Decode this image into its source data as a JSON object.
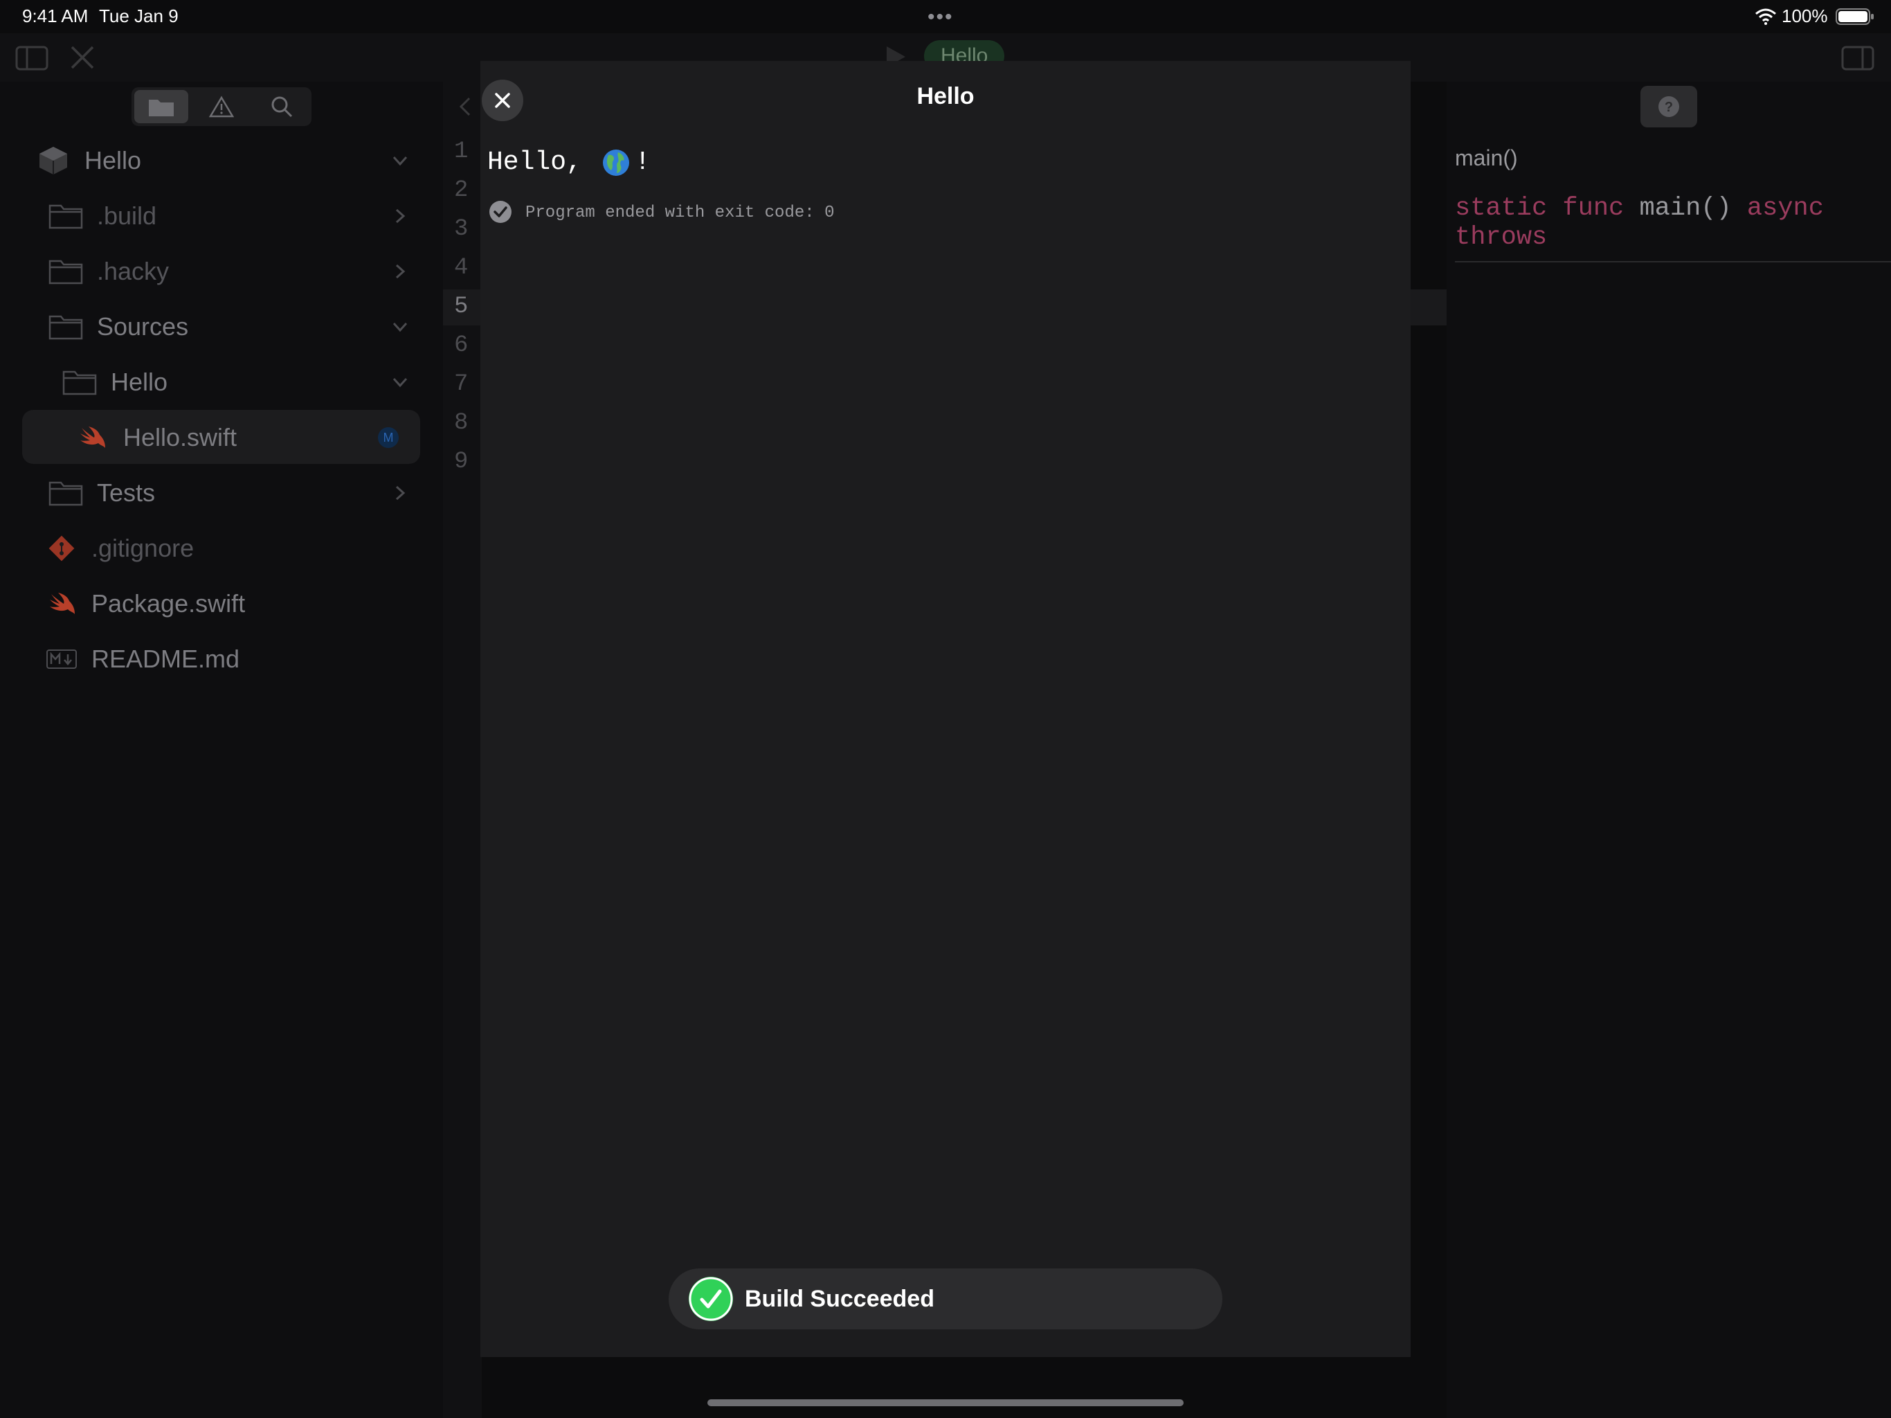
{
  "status_bar": {
    "time": "9:41 AM",
    "date": "Tue Jan 9",
    "battery": "100%",
    "multitask": "•••"
  },
  "toolbar": {
    "scheme": "Hello",
    "icons": [
      "sidebar-icon",
      "close-icon",
      "play-icon",
      "inspector-icon"
    ]
  },
  "navigator": {
    "tabs": [
      "folder-icon",
      "warning-icon",
      "magnifier-icon"
    ],
    "tree": [
      {
        "label": "Hello",
        "icon": "package-icon",
        "expanded": true
      },
      {
        "label": ".build",
        "icon": "folder-icon",
        "expanded": false
      },
      {
        "label": ".hacky",
        "icon": "folder-icon",
        "expanded": false
      },
      {
        "label": "Sources",
        "icon": "folder-icon",
        "expanded": true
      },
      {
        "label": "Hello",
        "icon": "folder-icon",
        "expanded": true
      },
      {
        "label": "Hello.swift",
        "icon": "swift-icon",
        "selected": true,
        "badge": "M"
      },
      {
        "label": "Tests",
        "icon": "folder-icon",
        "expanded": false
      },
      {
        "label": ".gitignore",
        "icon": "git-icon"
      },
      {
        "label": "Package.swift",
        "icon": "swift-icon"
      },
      {
        "label": "README.md",
        "icon": "markdown-icon"
      }
    ]
  },
  "editor": {
    "line_numbers": [
      "1",
      "2",
      "3",
      "4",
      "5",
      "6",
      "7",
      "8",
      "9"
    ],
    "current_line": "5"
  },
  "inspector": {
    "symbol": "main()",
    "decl_kw1": "static func",
    "decl_name": "main()",
    "decl_kw2": "async",
    "decl_kw3": "throws"
  },
  "run_sheet": {
    "title": "Hello",
    "output_before": "Hello,",
    "output_after": "!",
    "exit_message": "Program ended with exit code: 0"
  },
  "toast": {
    "label": "Build Succeeded"
  },
  "colors": {
    "accent_success": "#30d158",
    "keyword": "#9b3c5e",
    "swift": "#f05138"
  }
}
